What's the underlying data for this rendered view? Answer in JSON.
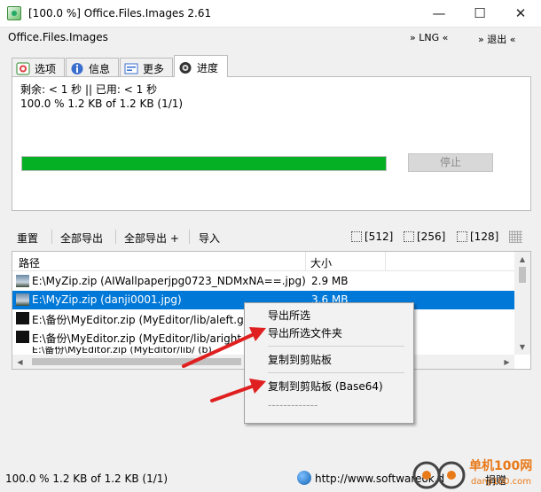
{
  "window": {
    "title": "[100.0 %] Office.Files.Images 2.61",
    "minimize": "—",
    "maximize": "☐",
    "close": "✕"
  },
  "menubar": {
    "app_name": "Office.Files.Images",
    "lng": "» LNG «",
    "exit": "» 退出 «"
  },
  "tabs": [
    {
      "label": "选项",
      "icon": "options-icon"
    },
    {
      "label": "信息",
      "icon": "info-icon"
    },
    {
      "label": "更多",
      "icon": "more-icon"
    },
    {
      "label": "进度",
      "icon": "progress-icon",
      "active": true
    }
  ],
  "progress_panel": {
    "remaining": "剩余: < 1 秒 || 已用: < 1 秒",
    "progress_text": "100.0 % 1.2 KB of 1.2 KB (1/1)",
    "progress_fraction": 1.0,
    "stop_label": "停止",
    "bar_color": "#06b025"
  },
  "toolbar": {
    "reset": "重置",
    "export_all": "全部导出",
    "export_all_plus": "全部导出 +",
    "import": "导入",
    "size_512": "[512]",
    "size_256": "[256]",
    "size_128": "[128]"
  },
  "list": {
    "columns": {
      "path": "路径",
      "size": "大小"
    },
    "rows": [
      {
        "path": "E:\\MyZip.zip (AIWallpaperjpg0723_NDMxNA==.jpg)",
        "size": "2.9 MB"
      },
      {
        "path": "E:\\MyZip.zip (danji0001.jpg)",
        "size": "3.6 MB",
        "selected": true
      },
      {
        "path": "E:\\备份\\MyEditor.zip (MyEditor/lib/aleft.gi",
        "size": ""
      },
      {
        "path": "E:\\备份\\MyEditor.zip (MyEditor/lib/aright",
        "size": ""
      },
      {
        "path": "E:\\备份\\MyEditor.zip (MyEditor/lib/ (b)",
        "size": ""
      }
    ]
  },
  "context_menu": {
    "items": [
      "导出所选",
      "导出所选文件夹",
      "复制到剪贴板",
      "复制到剪贴板 (Base64)"
    ],
    "disabled": "-------------"
  },
  "statusbar": {
    "left": "100.0 % 1.2 KB of 1.2 KB (1/1)",
    "url": "http://www.softwareok.d",
    "donate": "捐赠"
  },
  "watermark": {
    "text": "单机100网",
    "sub": "danji100.com"
  },
  "colors": {
    "selection": "#0078d7",
    "arrow": "#e02020"
  }
}
